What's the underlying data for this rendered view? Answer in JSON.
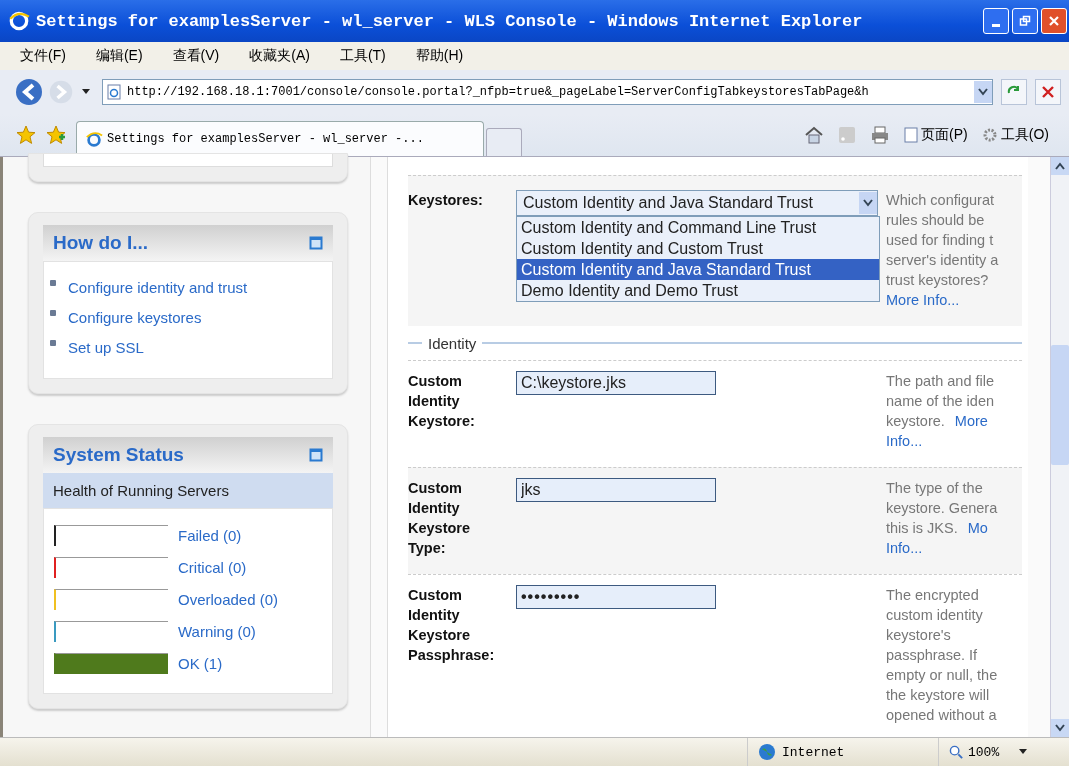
{
  "window": {
    "title": "Settings for examplesServer - wl_server - WLS Console - Windows Internet Explorer"
  },
  "menu": [
    "文件(F)",
    "编辑(E)",
    "查看(V)",
    "收藏夹(A)",
    "工具(T)",
    "帮助(H)"
  ],
  "address": {
    "url": "http://192.168.18.1:7001/console/console.portal?_nfpb=true&_pageLabel=ServerConfigTabkeystoresTabPage&h"
  },
  "tab": {
    "title": "Settings for examplesServer - wl_server -...",
    "selected": true
  },
  "toolbar": [
    "页面(P)",
    "工具(O)"
  ],
  "how_do_i": {
    "title": "How do I...",
    "links": [
      "Configure identity and trust",
      "Configure keystores",
      "Set up SSL"
    ]
  },
  "system_status": {
    "title": "System Status",
    "subtitle": "Health of Running Servers",
    "items": [
      {
        "label": "Failed (0)",
        "color": "#222222",
        "level": 0
      },
      {
        "label": "Critical (0)",
        "color": "#e02020",
        "level": 0
      },
      {
        "label": "Overloaded (0)",
        "color": "#f0c020",
        "level": 0
      },
      {
        "label": "Warning (0)",
        "color": "#3a9ac0",
        "level": 0
      },
      {
        "label": "OK (1)",
        "color": "#4f7a1c",
        "level": 1
      }
    ]
  },
  "keystores": {
    "label": "Keystores:",
    "value": "Custom Identity and Java Standard Trust",
    "expanded": true,
    "options": [
      {
        "text": "Custom Identity and Command Line Trust",
        "selected": false
      },
      {
        "text": "Custom Identity and Custom Trust",
        "selected": false
      },
      {
        "text": "Custom Identity and Java Standard Trust",
        "selected": true
      },
      {
        "text": "Demo Identity and Demo Trust",
        "selected": false
      }
    ],
    "help": [
      {
        "text": "Which configurat"
      },
      {
        "text": "rules should be"
      },
      {
        "text": "used for finding t"
      },
      {
        "text": "server's identity a"
      },
      {
        "text": "trust keystores?"
      },
      {
        "link": "More Info..."
      }
    ]
  },
  "section": "Identity",
  "fields": [
    {
      "label": "Custom Identity Keystore:",
      "value": "C:\\keystore.jks",
      "kind": "text",
      "help": [
        {
          "text": "The path and file"
        },
        {
          "text": "name of the iden"
        },
        {
          "text": "keystore.",
          "link": "More"
        },
        {
          "link": "Info..."
        }
      ]
    },
    {
      "label": "Custom Identity Keystore Type:",
      "value": "jks",
      "kind": "text",
      "help": [
        {
          "text": "The type of the"
        },
        {
          "text": "keystore. Genera"
        },
        {
          "text": "this is JKS.",
          "link": "Mo"
        },
        {
          "link": "Info..."
        }
      ]
    },
    {
      "label": "Custom Identity Keystore Passphrase:",
      "value": "•••••••••",
      "kind": "password",
      "help": [
        {
          "text": "The encrypted"
        },
        {
          "text": "custom identity"
        },
        {
          "text": "keystore's"
        },
        {
          "text": "passphrase. If"
        },
        {
          "text": "empty or null, the"
        },
        {
          "text": "the keystore will"
        },
        {
          "text": "opened without a"
        }
      ]
    }
  ],
  "status_bar": {
    "zone": "Internet",
    "zoom": "100%"
  }
}
